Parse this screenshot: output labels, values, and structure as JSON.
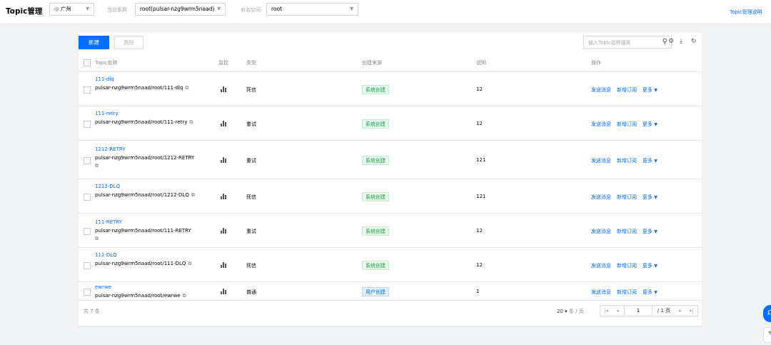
{
  "header": {
    "title": "Topic管理",
    "region": "广州",
    "cluster_label": "当前集群",
    "cluster": "root(pulsar-nzg9wrm5naad)",
    "namespace_label": "命名空间",
    "namespace": "root",
    "help_link": "Topic管理说明"
  },
  "toolbar": {
    "new_label": "新建",
    "delete_label": "删除",
    "search_placeholder": "输入Topic名称搜索"
  },
  "table": {
    "columns": [
      "Topic名称",
      "监控",
      "类型",
      "创建来源",
      "说明",
      "操作"
    ],
    "rows": [
      {
        "name": "111-dlq",
        "path": "pulsar-nzg9wrm5naad/root/111-dlq",
        "type": "死信",
        "source": "系统创建",
        "desc": "12"
      },
      {
        "name": "111-retry",
        "path": "pulsar-nzg9wrm5naad/root/111-retry",
        "type": "重试",
        "source": "系统创建",
        "desc": "12"
      },
      {
        "name": "1212-RETRY",
        "path": "pulsar-nzg9wrm5naad/root/1212-RETRY",
        "type": "重试",
        "source": "系统创建",
        "desc": "121"
      },
      {
        "name": "1212-DLQ",
        "path": "pulsar-nzg9wrm5naad/root/1212-DLQ",
        "type": "死信",
        "source": "系统创建",
        "desc": "121"
      },
      {
        "name": "111-RETRY",
        "path": "pulsar-nzg9wrm5naad/root/111-RETRY",
        "type": "重试",
        "source": "系统创建",
        "desc": "12"
      },
      {
        "name": "111-DLQ",
        "path": "pulsar-nzg9wrm5naad/root/111-DLQ",
        "type": "死信",
        "source": "系统创建",
        "desc": "12"
      },
      {
        "name": "ewrwe",
        "path": "pulsar-nzg9wrm5naad/root/ewrwe",
        "type": "普通",
        "source": "用户创建",
        "desc": "1"
      }
    ],
    "actions": {
      "send": "发送消息",
      "subscribe": "新增订阅",
      "more": "更多"
    }
  },
  "footer": {
    "total": "共 7 条",
    "page_size": "20",
    "page_size_unit": "条 / 页",
    "page": "1",
    "page_total": "/ 1 页"
  },
  "icons": {
    "region": "globe-icon",
    "search": "search-icon",
    "settings": "gear-icon",
    "download": "download-icon",
    "refresh": "refresh-icon",
    "copy": "copy-icon",
    "monitor": "bar-chart-icon"
  },
  "colors": {
    "accent": "#006eff",
    "system_tag": "#1b9e4b",
    "user_tag": "#006eff"
  }
}
